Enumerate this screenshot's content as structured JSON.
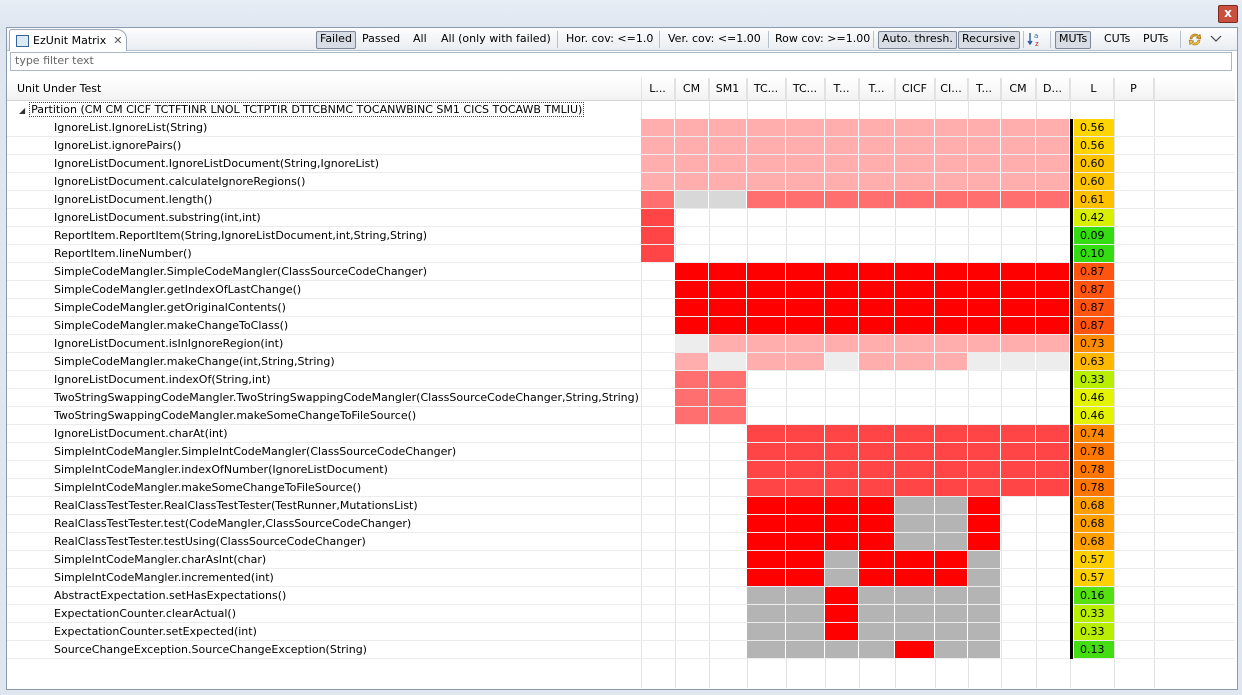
{
  "view": {
    "tab_title": "EzUnit Matrix",
    "filter_placeholder": "type filter text"
  },
  "toolbar": {
    "failed": "Failed",
    "passed": "Passed",
    "all": "All",
    "all_with_failed": "All (only with failed)",
    "hor_cov": "Hor. cov: <=1.0",
    "ver_cov": "Ver. cov: <=1.00",
    "row_cov": "Row cov: >=1.00",
    "auto_thresh": "Auto. thresh.",
    "recursive": "Recursive",
    "sort_icon": "sort-az-icon",
    "muts": "MUTs",
    "cuts": "CUTs",
    "puts": "PUTs",
    "sync_icon": "sync-icon",
    "menu_icon": "view-menu-icon"
  },
  "table": {
    "unit_header": "Unit Under Test",
    "test_columns": [
      "L...",
      "CM",
      "SM1",
      "TC...",
      "TC...",
      "T...",
      "T...",
      "CICF",
      "CI...",
      "T...",
      "CM",
      "D..."
    ],
    "metric_columns": [
      "L",
      "P"
    ],
    "partition_label": "Partition (CM CM CICF TCTFTINR LNOL TCTPTIR DTTCBNMC TOCANWBINC SM1 CICS TOCAWB TMLIU)",
    "rows": [
      {
        "label": "IgnoreList.IgnoreList(String)",
        "cells": [
          "p",
          "p",
          "p",
          "p",
          "p",
          "p",
          "p",
          "p",
          "p",
          "p",
          "p",
          "p"
        ],
        "l": "0.56",
        "lcolor": "#ffd400"
      },
      {
        "label": "IgnoreList.ignorePairs()",
        "cells": [
          "p",
          "p",
          "p",
          "p",
          "p",
          "p",
          "p",
          "p",
          "p",
          "p",
          "p",
          "p"
        ],
        "l": "0.56",
        "lcolor": "#ffd400"
      },
      {
        "label": "IgnoreListDocument.IgnoreListDocument(String,IgnoreList)",
        "cells": [
          "p",
          "p",
          "p",
          "p",
          "p",
          "p",
          "p",
          "p",
          "p",
          "p",
          "p",
          "p"
        ],
        "l": "0.60",
        "lcolor": "#ffc400"
      },
      {
        "label": "IgnoreListDocument.calculateIgnoreRegions()",
        "cells": [
          "p",
          "p",
          "p",
          "p",
          "p",
          "p",
          "p",
          "p",
          "p",
          "p",
          "p",
          "p"
        ],
        "l": "0.60",
        "lcolor": "#ffc400"
      },
      {
        "label": "IgnoreListDocument.length()",
        "cells": [
          "m",
          "g",
          "g",
          "m",
          "m",
          "m",
          "m",
          "m",
          "m",
          "m",
          "m",
          "m"
        ],
        "l": "0.61",
        "lcolor": "#ffc000"
      },
      {
        "label": "IgnoreListDocument.substring(int,int)",
        "cells": [
          "o",
          "_",
          "_",
          "_",
          "_",
          "_",
          "_",
          "_",
          "_",
          "_",
          "_",
          "_"
        ],
        "l": "0.42",
        "lcolor": "#d8f000"
      },
      {
        "label": "ReportItem.ReportItem(String,IgnoreListDocument,int,String,String)",
        "cells": [
          "o",
          "_",
          "_",
          "_",
          "_",
          "_",
          "_",
          "_",
          "_",
          "_",
          "_",
          "_"
        ],
        "l": "0.09",
        "lcolor": "#33dd11"
      },
      {
        "label": "ReportItem.lineNumber()",
        "cells": [
          "o",
          "_",
          "_",
          "_",
          "_",
          "_",
          "_",
          "_",
          "_",
          "_",
          "_",
          "_"
        ],
        "l": "0.10",
        "lcolor": "#33dd11"
      },
      {
        "label": "SimpleCodeMangler.SimpleCodeMangler(ClassSourceCodeChanger)",
        "cells": [
          "_",
          "r",
          "r",
          "r",
          "r",
          "r",
          "r",
          "r",
          "r",
          "r",
          "r",
          "r"
        ],
        "l": "0.87",
        "lcolor": "#ff5511"
      },
      {
        "label": "SimpleCodeMangler.getIndexOfLastChange()",
        "cells": [
          "_",
          "r",
          "r",
          "r",
          "r",
          "r",
          "r",
          "r",
          "r",
          "r",
          "r",
          "r"
        ],
        "l": "0.87",
        "lcolor": "#ff5511"
      },
      {
        "label": "SimpleCodeMangler.getOriginalContents()",
        "cells": [
          "_",
          "r",
          "r",
          "r",
          "r",
          "r",
          "r",
          "r",
          "r",
          "r",
          "r",
          "r"
        ],
        "l": "0.87",
        "lcolor": "#ff5511"
      },
      {
        "label": "SimpleCodeMangler.makeChangeToClass()",
        "cells": [
          "_",
          "r",
          "r",
          "r",
          "r",
          "r",
          "r",
          "r",
          "r",
          "r",
          "r",
          "r"
        ],
        "l": "0.87",
        "lcolor": "#ff5511"
      },
      {
        "label": "IgnoreListDocument.isInIgnoreRegion(int)",
        "cells": [
          "_",
          "w",
          "p",
          "p",
          "p",
          "p",
          "p",
          "p",
          "p",
          "p",
          "p",
          "p"
        ],
        "l": "0.73",
        "lcolor": "#ff8c00"
      },
      {
        "label": "SimpleCodeMangler.makeChange(int,String,String)",
        "cells": [
          "_",
          "p",
          "w",
          "p",
          "p",
          "w",
          "p",
          "p",
          "p",
          "w",
          "w",
          "w"
        ],
        "l": "0.63",
        "lcolor": "#ffb800"
      },
      {
        "label": "IgnoreListDocument.indexOf(String,int)",
        "cells": [
          "_",
          "m",
          "m",
          "_",
          "_",
          "_",
          "_",
          "_",
          "_",
          "_",
          "_",
          "_"
        ],
        "l": "0.33",
        "lcolor": "#b8ee00"
      },
      {
        "label": "TwoStringSwappingCodeMangler.TwoStringSwappingCodeMangler(ClassSourceCodeChanger,String,String)",
        "cells": [
          "_",
          "m",
          "m",
          "_",
          "_",
          "_",
          "_",
          "_",
          "_",
          "_",
          "_",
          "_"
        ],
        "l": "0.46",
        "lcolor": "#e4f400"
      },
      {
        "label": "TwoStringSwappingCodeMangler.makeSomeChangeToFileSource()",
        "cells": [
          "_",
          "m",
          "m",
          "_",
          "_",
          "_",
          "_",
          "_",
          "_",
          "_",
          "_",
          "_"
        ],
        "l": "0.46",
        "lcolor": "#e4f400"
      },
      {
        "label": "IgnoreListDocument.charAt(int)",
        "cells": [
          "_",
          "_",
          "_",
          "o",
          "o",
          "o",
          "o",
          "o",
          "o",
          "o",
          "o",
          "o"
        ],
        "l": "0.74",
        "lcolor": "#ff8800"
      },
      {
        "label": "SimpleIntCodeMangler.SimpleIntCodeMangler(ClassSourceCodeChanger)",
        "cells": [
          "_",
          "_",
          "_",
          "o",
          "o",
          "o",
          "o",
          "o",
          "o",
          "o",
          "o",
          "o"
        ],
        "l": "0.78",
        "lcolor": "#ff7700"
      },
      {
        "label": "SimpleIntCodeMangler.indexOfNumber(IgnoreListDocument)",
        "cells": [
          "_",
          "_",
          "_",
          "o",
          "o",
          "o",
          "o",
          "o",
          "o",
          "o",
          "o",
          "o"
        ],
        "l": "0.78",
        "lcolor": "#ff7700"
      },
      {
        "label": "SimpleIntCodeMangler.makeSomeChangeToFileSource()",
        "cells": [
          "_",
          "_",
          "_",
          "o",
          "o",
          "o",
          "o",
          "o",
          "o",
          "o",
          "o",
          "o"
        ],
        "l": "0.78",
        "lcolor": "#ff7700"
      },
      {
        "label": "RealClassTestTester.RealClassTestTester(TestRunner,MutationsList)",
        "cells": [
          "_",
          "_",
          "_",
          "r",
          "r",
          "r",
          "r",
          "G",
          "G",
          "r",
          "_",
          "_"
        ],
        "l": "0.68",
        "lcolor": "#ffa000"
      },
      {
        "label": "RealClassTestTester.test(CodeMangler,ClassSourceCodeChanger)",
        "cells": [
          "_",
          "_",
          "_",
          "r",
          "r",
          "r",
          "r",
          "G",
          "G",
          "r",
          "_",
          "_"
        ],
        "l": "0.68",
        "lcolor": "#ffa000"
      },
      {
        "label": "RealClassTestTester.testUsing(ClassSourceCodeChanger)",
        "cells": [
          "_",
          "_",
          "_",
          "r",
          "r",
          "r",
          "r",
          "G",
          "G",
          "r",
          "_",
          "_"
        ],
        "l": "0.68",
        "lcolor": "#ffa000"
      },
      {
        "label": "SimpleIntCodeMangler.charAsInt(char)",
        "cells": [
          "_",
          "_",
          "_",
          "r",
          "r",
          "G",
          "r",
          "r",
          "r",
          "G",
          "_",
          "_"
        ],
        "l": "0.57",
        "lcolor": "#ffd000"
      },
      {
        "label": "SimpleIntCodeMangler.incremented(int)",
        "cells": [
          "_",
          "_",
          "_",
          "r",
          "r",
          "G",
          "r",
          "r",
          "r",
          "G",
          "_",
          "_"
        ],
        "l": "0.57",
        "lcolor": "#ffd000"
      },
      {
        "label": "AbstractExpectation.setHasExpectations()",
        "cells": [
          "_",
          "_",
          "_",
          "G",
          "G",
          "r",
          "G",
          "G",
          "G",
          "G",
          "_",
          "_"
        ],
        "l": "0.16",
        "lcolor": "#55e011"
      },
      {
        "label": "ExpectationCounter.clearActual()",
        "cells": [
          "_",
          "_",
          "_",
          "G",
          "G",
          "r",
          "G",
          "G",
          "G",
          "G",
          "_",
          "_"
        ],
        "l": "0.33",
        "lcolor": "#b8ee00"
      },
      {
        "label": "ExpectationCounter.setExpected(int)",
        "cells": [
          "_",
          "_",
          "_",
          "G",
          "G",
          "r",
          "G",
          "G",
          "G",
          "G",
          "_",
          "_"
        ],
        "l": "0.33",
        "lcolor": "#b8ee00"
      },
      {
        "label": "SourceChangeException.SourceChangeException(String)",
        "cells": [
          "_",
          "_",
          "_",
          "G",
          "G",
          "G",
          "G",
          "r",
          "G",
          "G",
          "_",
          "_"
        ],
        "l": "0.13",
        "lcolor": "#44dd11"
      }
    ]
  },
  "colors": {
    "p": "#ffadad",
    "m": "#ff6f6f",
    "o": "#ff4545",
    "r": "#ff0000",
    "g": "#d8d8d8",
    "G": "#b4b4b4",
    "w": "#ededed",
    "_": "transparent"
  }
}
